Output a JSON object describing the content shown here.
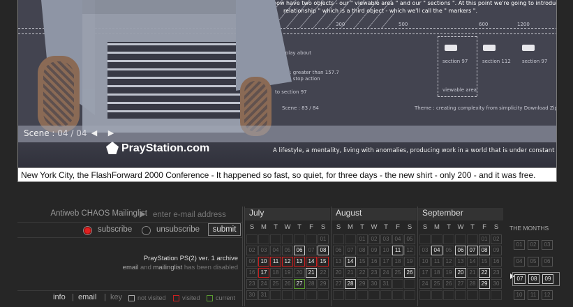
{
  "hero": {
    "bg_lines": [
      "now have two objects - our \" viewable area \" and our \" sections \". At this point we're going to introduce the",
      "relationship \" which is a third object - which we'll call the \" markers \".",
      "- play  about",
      "when : greater than 157.7",
      "when : stop  action",
      "to section 97",
      "Scene : 83 / 84",
      "Theme : creating  complexity  from  simplicity    Download Zip Fil",
      "section 97",
      "section 112",
      "section 97",
      "viewable area"
    ],
    "axis_ticks": [
      "300",
      "500",
      "600",
      "1200"
    ],
    "scene_label": "Scene :",
    "scene_value": "04 / 04",
    "prev_icon": "◀",
    "next_icon": "▶",
    "logo": "PrayStation.com",
    "tagline": "A lifestyle, a mentality, living with anomalies, producing work in a world that is under constant flux and change.",
    "caption": "New York City, the FlashForward 2000 Conference  -  It happened so fast, so quiet, for three days  -  the new shirt  -  only 200  -  and it was free."
  },
  "mailing": {
    "title": "Antiweb CHAOS Mailinglist",
    "email_placeholder": "enter e-mail address",
    "subscribe": "subscribe",
    "unsubscribe": "unsubscribe",
    "submit": "submit",
    "archive_line": "PrayStation PS(2) ver. 1 archive",
    "status_a": "email",
    "status_and": "and",
    "status_b": "mailinglist",
    "status_c": "has been disabled"
  },
  "footer": {
    "info": "info",
    "email": "email",
    "key": "key",
    "not_visited": "not visited",
    "visited": "visited",
    "current": "current"
  },
  "calendar": {
    "dow": [
      "S",
      "M",
      "T",
      "W",
      "T",
      "F",
      "S"
    ],
    "months": [
      {
        "name": "July",
        "offset": 6,
        "days": 31,
        "visited": [
          6,
          8,
          21
        ],
        "red": [
          10,
          11,
          12,
          13,
          14,
          15,
          17
        ],
        "green": [
          27
        ]
      },
      {
        "name": "August",
        "offset": 2,
        "days": 31,
        "visited": [
          11,
          14,
          26,
          28
        ],
        "red": [],
        "green": []
      },
      {
        "name": "September",
        "offset": 5,
        "days": 30,
        "visited": [
          4,
          6,
          7,
          8,
          20,
          22,
          29
        ],
        "red": [],
        "green": []
      }
    ],
    "months_title": "THE MONTHS",
    "month_numbers": [
      "01",
      "02",
      "03",
      "04",
      "05",
      "06",
      "07",
      "08",
      "09",
      "10",
      "11",
      "12"
    ],
    "active_months": [
      "07",
      "08",
      "09"
    ],
    "selector_icon": "▶"
  }
}
